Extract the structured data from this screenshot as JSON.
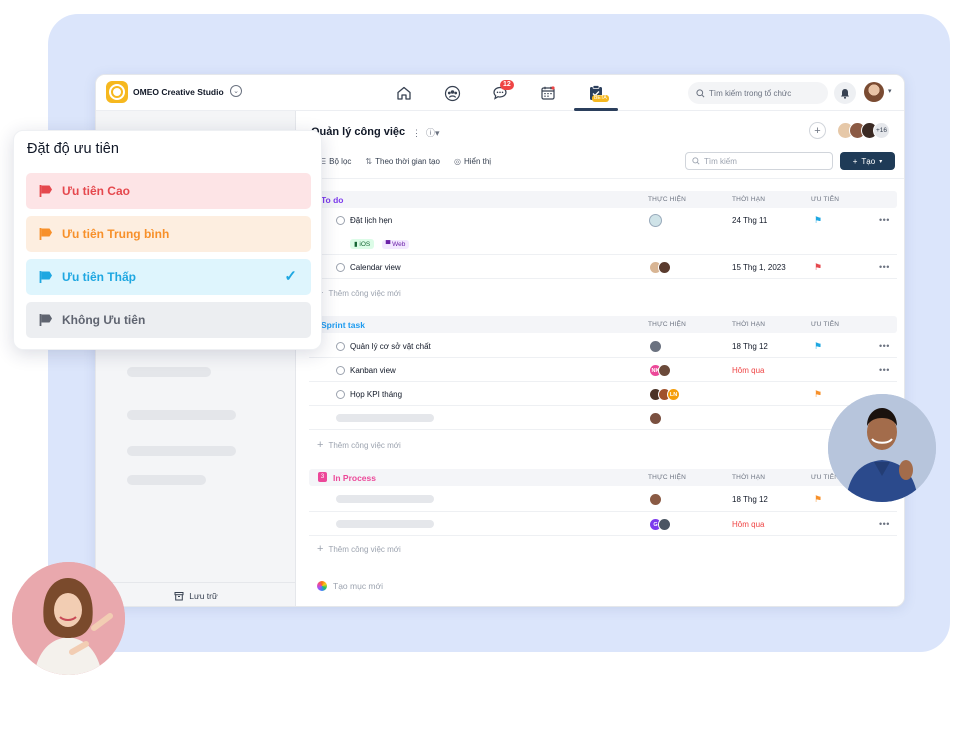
{
  "topbar": {
    "org_name": "OMEO Creative Studio",
    "chat_badge": "12",
    "beta_label": "BETA",
    "search_placeholder": "Tìm kiếm trong tổ chức"
  },
  "sidebar": {
    "archive_label": "Lưu trữ"
  },
  "main": {
    "title": "Quản lý công việc",
    "filters": [
      "Bộ lọc",
      "Theo thời gian tạo",
      "Hiển thị"
    ],
    "search_placeholder": "Tìm kiếm",
    "create_label": "Tạo",
    "members_more": "+16",
    "add_task_label": "Thêm công việc mới",
    "create_category_label": "Tạo mục mới",
    "columns": {
      "assignee": "THỰC HIỆN",
      "deadline": "THỜI HẠN",
      "priority": "ƯU TIÊN"
    }
  },
  "groups": [
    {
      "name": "To do",
      "color": "#7c3aed",
      "tasks": [
        {
          "name": "Đặt lịch hẹn",
          "deadline": "24 Thg 11",
          "priority": "low",
          "tags": [
            "iOS",
            "Web"
          ]
        },
        {
          "name": "Calendar view",
          "deadline": "15 Thg 1, 2023",
          "priority": "high"
        }
      ]
    },
    {
      "name": "Sprint task",
      "color": "#1d9bf0",
      "tasks": [
        {
          "name": "Quản lý cơ sở vật chất",
          "deadline": "18 Thg 12",
          "priority": "low"
        },
        {
          "name": "Kanban view",
          "deadline": "Hôm qua",
          "priority": "",
          "initials": "NK"
        },
        {
          "name": "Họp KPI tháng",
          "deadline": "",
          "priority": "medium",
          "initials": "LN"
        }
      ]
    },
    {
      "name": "In Process",
      "number": "3",
      "color": "#ec4899",
      "tasks": [
        {
          "deadline": "18 Thg 12",
          "priority": "medium"
        },
        {
          "deadline": "Hôm qua",
          "priority": "",
          "initials": "G"
        }
      ]
    }
  ],
  "priority_popup": {
    "title": "Đặt độ ưu tiên",
    "options": [
      {
        "label": "Ưu tiên Cao",
        "color": "#e5484d",
        "bg": "#fde4e6"
      },
      {
        "label": "Ưu tiên Trung bình",
        "color": "#f7902a",
        "bg": "#fdeee0"
      },
      {
        "label": "Ưu tiên Thấp",
        "color": "#1ea7e1",
        "bg": "#def5fd",
        "selected": true
      },
      {
        "label": "Không Ưu tiên",
        "color": "#5f6470",
        "bg": "#eceef1"
      }
    ]
  }
}
